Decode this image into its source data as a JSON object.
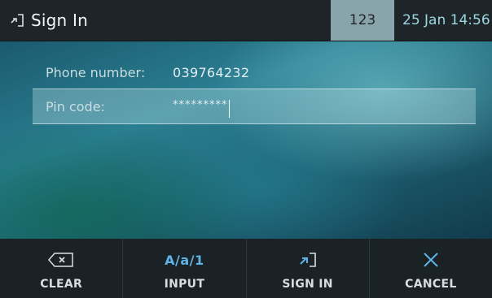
{
  "header": {
    "title": "Sign In",
    "title_icon": "sign-in-icon",
    "input_mode": "123",
    "datetime": "25 Jan 14:56"
  },
  "form": {
    "phone": {
      "label": "Phone number:",
      "value": "039764232"
    },
    "pin": {
      "label": "Pin code:",
      "value": "*********"
    }
  },
  "softkeys": {
    "clear": {
      "label": "CLEAR",
      "icon": "backspace-icon"
    },
    "input": {
      "label": "INPUT",
      "icon_text": "A/a/1"
    },
    "sign_in": {
      "label": "SIGN IN",
      "icon": "sign-in-icon"
    },
    "cancel": {
      "label": "CANCEL",
      "icon": "close-icon"
    }
  },
  "colors": {
    "accent": "#5fb3e6",
    "datetime": "#9ed6e2",
    "mode_badge_bg": "#8aa4ab",
    "bar_bg": "#1a2225"
  }
}
